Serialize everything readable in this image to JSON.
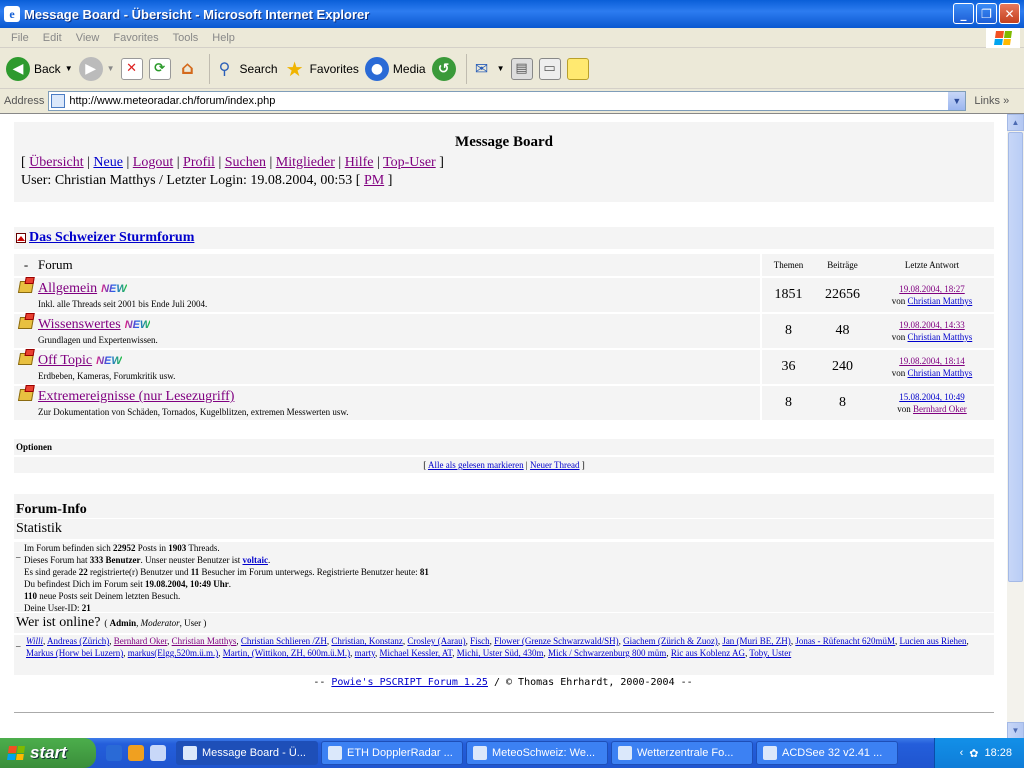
{
  "window": {
    "title": "Message Board - Übersicht - Microsoft Internet Explorer"
  },
  "menu": [
    "File",
    "Edit",
    "View",
    "Favorites",
    "Tools",
    "Help"
  ],
  "toolbar": {
    "back": "Back",
    "search": "Search",
    "favorites": "Favorites",
    "media": "Media"
  },
  "address": {
    "label": "Address",
    "url": "http://www.meteoradar.ch/forum/index.php",
    "links": "Links"
  },
  "board": {
    "title": "Message Board",
    "nav": [
      "Übersicht",
      "Neue",
      "Logout",
      "Profil",
      "Suchen",
      "Mitglieder",
      "Hilfe",
      "Top-User"
    ],
    "user_text": "User: Christian Matthys / Letzter Login: 19.08.2004, 00:53 [",
    "pm": "PM",
    "category": "Das Schweizer Sturmforum",
    "headers": {
      "dash": "-",
      "forum": "Forum",
      "themen": "Themen",
      "beitraege": "Beiträge",
      "letzte": "Letzte Antwort"
    },
    "forums": [
      {
        "name": "Allgemein",
        "new": "NEW",
        "desc": "Inkl. alle Threads seit 2001 bis Ende Juli 2004.",
        "themen": "1851",
        "beitraege": "22656",
        "date": "19.08.2004, 18:27",
        "von": "von",
        "user": "Christian Matthys"
      },
      {
        "name": "Wissenswertes",
        "new": "NEW",
        "desc": "Grundlagen und Expertenwissen.",
        "themen": "8",
        "beitraege": "48",
        "date": "19.08.2004, 14:33",
        "von": "von",
        "user": "Christian Matthys"
      },
      {
        "name": "Off Topic",
        "new": "NEW",
        "desc": "Erdbeben, Kameras, Forumkritik usw.",
        "themen": "36",
        "beitraege": "240",
        "date": "19.08.2004, 18:14",
        "von": "von",
        "user": "Christian Matthys"
      },
      {
        "name": "Extremereignisse (nur Lesezugriff)",
        "new": "",
        "desc": "Zur Dokumentation von Schäden, Tornados, Kugelblitzen, extremen Messwerten usw.",
        "themen": "8",
        "beitraege": "8",
        "date": "15.08.2004, 10:49",
        "von": "von",
        "user": "Bernhard Oker"
      }
    ],
    "options_label": "Optionen",
    "mark_all": "Alle als gelesen markieren",
    "new_thread": "Neuer Thread",
    "forum_info": "Forum-Info",
    "statistik": "Statistik",
    "stats": {
      "l1a": "Im Forum befinden sich ",
      "posts": "22952",
      "l1b": " Posts in ",
      "threads": "1903",
      "l1c": " Threads.",
      "l2a": "Dieses Forum hat ",
      "members": "333",
      "l2b": " Benutzer",
      "l2c": ". Unser neuster Benutzer ist ",
      "newest": "voltaic",
      "l2d": ".",
      "l3a": "Es sind gerade ",
      "reg": "22",
      "l3b": " registrierte(r) Benutzer und ",
      "guests": "11",
      "l3c": " Besucher im Forum unterwegs. Registrierte Benutzer heute: ",
      "today": "81",
      "l4a": "Du befindest Dich im Forum seit ",
      "since": "19.08.2004, 10:49 Uhr",
      "l4b": ".",
      "newposts": "110",
      "l5": " neue Posts seit Deinem letzten Besuch.",
      "l6": "Deine User-ID: ",
      "uid": "21"
    },
    "online_title": "Wer ist online?",
    "online_legend": {
      "open": "(",
      "admin": "Admin",
      "comma1": ", ",
      "mod": "Moderator",
      "comma2": ", ",
      "user": "User",
      "close": ")"
    },
    "online_users": [
      "Willi",
      "Andreas (Zürich)",
      "Bernhard Oker",
      "Christian Matthys",
      "Christian Schlieren /ZH",
      "Christian, Konstanz",
      "Crosley (Aarau)",
      "Fisch",
      "Flower (Grenze Schwarzwald/SH)",
      "Giachem (Zürich & Zuoz)",
      "Jan (Muri BE, ZH)",
      "Jonas - Rüfenacht 620müM",
      "Lucien aus Riehen",
      "Markus (Horw bei Luzern)",
      "markus(Elgg,520m.ü.m.)",
      "Martin, (Wittikon, ZH, 600m.ü.M.)",
      "marty",
      "Michael Kessler, AT",
      "Michi, Uster Süd, 430m",
      "Mick / Schwarzenburg 800 müm",
      "Ric aus Koblenz AG",
      "Toby, Uster"
    ],
    "footer_pre": "-- ",
    "footer_link": "Powie's PSCRIPT Forum 1.25",
    "footer_post": " / © Thomas Ehrhardt, 2000-2004 --"
  },
  "taskbar": {
    "start": "start",
    "tasks": [
      "Message Board - Ü...",
      "ETH DopplerRadar ...",
      "MeteoSchweiz: We...",
      "Wetterzentrale Fo...",
      "ACDSee 32 v2.41 ..."
    ],
    "clock": "18:28"
  }
}
